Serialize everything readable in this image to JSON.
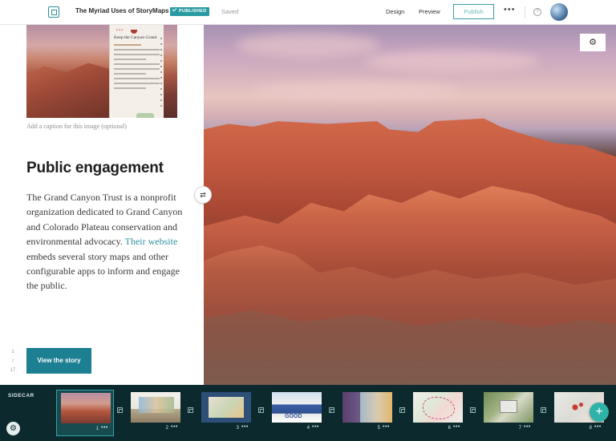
{
  "header": {
    "title": "The Myriad Uses of StoryMaps",
    "badge": "PUBLISHED",
    "status": "Saved",
    "nav": {
      "design": "Design",
      "preview": "Preview"
    },
    "publish_label": "Publish",
    "more_label": "•••",
    "help_label": "?"
  },
  "left": {
    "thumbnail_card_title": "Keep the Canyon Grand",
    "caption_placeholder": "Add a caption for this image (optional)",
    "heading": "Public engagement",
    "body_before_link": "The Grand Canyon Trust is a nonprofit organization dedicated to Grand Canyon and Colorado Plateau conservation and environmental advocacy.",
    "body_link": "Their website",
    "body_after_link": "embeds several story maps and other configurable apps to inform and engage the public.",
    "page_indicator": {
      "current": "1",
      "separator": "/",
      "total": "17"
    },
    "cta_label": "View the story",
    "swap_glyph": "⇄"
  },
  "media": {
    "settings_glyph": "⚙"
  },
  "sidecar": {
    "label": "SIDECAR",
    "gear_glyph": "⚙",
    "add_glyph": "+",
    "slides": [
      {
        "number": "1",
        "more": "•••"
      },
      {
        "number": "2",
        "more": "•••"
      },
      {
        "number": "3",
        "more": "•••"
      },
      {
        "number": "4",
        "more": "•••"
      },
      {
        "number": "5",
        "more": "•••"
      },
      {
        "number": "6",
        "more": "•••"
      },
      {
        "number": "7",
        "more": "•••"
      },
      {
        "number": "8",
        "more": "•••"
      }
    ]
  },
  "colors": {
    "accent": "#1c7f92",
    "badge": "#2a9aa2",
    "link": "#2d8ea0",
    "sidecar_bar": "#0c2a2e",
    "add_button": "#2fb3a8"
  }
}
